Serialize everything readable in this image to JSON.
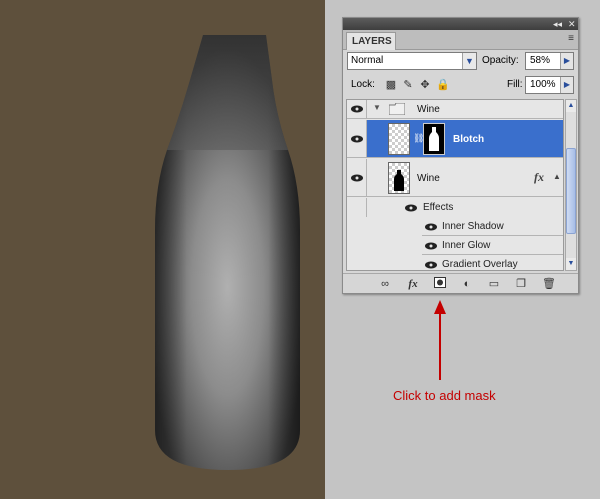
{
  "panel": {
    "tab_label": "LAYERS",
    "titlebar_collapse": "◂◂",
    "titlebar_close": "✕",
    "menu_icon": "≡",
    "blend_mode": "Normal",
    "opacity_label": "Opacity:",
    "opacity_value": "58%",
    "lock_label": "Lock:",
    "fill_label": "Fill:",
    "fill_value": "100%"
  },
  "layers": {
    "group_name": "Wine",
    "layer_blotch": "Blotch",
    "layer_wine": "Wine",
    "fx_badge": "fx",
    "effects_label": "Effects",
    "effects": [
      "Inner Shadow",
      "Inner Glow",
      "Gradient Overlay"
    ]
  },
  "bottom_icons": [
    "link-layers",
    "add-layer-style",
    "add-layer-mask",
    "new-adjustment-layer",
    "new-group",
    "new-layer",
    "delete-layer"
  ],
  "annotation": {
    "caption": "Click to add mask",
    "color": "#c40000"
  },
  "colors": {
    "canvas_bg": "#5e503c",
    "selected_row": "#3a6fcc"
  }
}
